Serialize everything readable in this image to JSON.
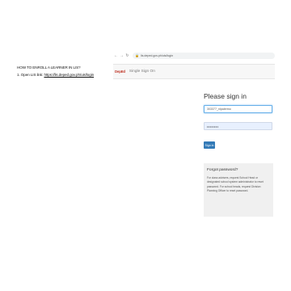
{
  "instructions": {
    "heading": "HOW TO ENROLL A LEARNER IN LIS?",
    "step_prefix": "1. Open LIS link: ",
    "step_link": "https://lis.deped.gov.ph/uis/login"
  },
  "browser": {
    "address": "lis.deped.gov.ph/uis/login"
  },
  "header": {
    "logo_text": "DepEd",
    "title": "Single Sign On"
  },
  "signin": {
    "title": "Please sign in",
    "username_value": "303377_nlpalermo",
    "password_value": "••••••••",
    "button_label": "Sign in"
  },
  "forgot": {
    "title": "Forgot password?",
    "text": "For class advisers, request School Head or designated school system administrator to reset password. For school heads, request Division Planning Officer to reset password."
  }
}
